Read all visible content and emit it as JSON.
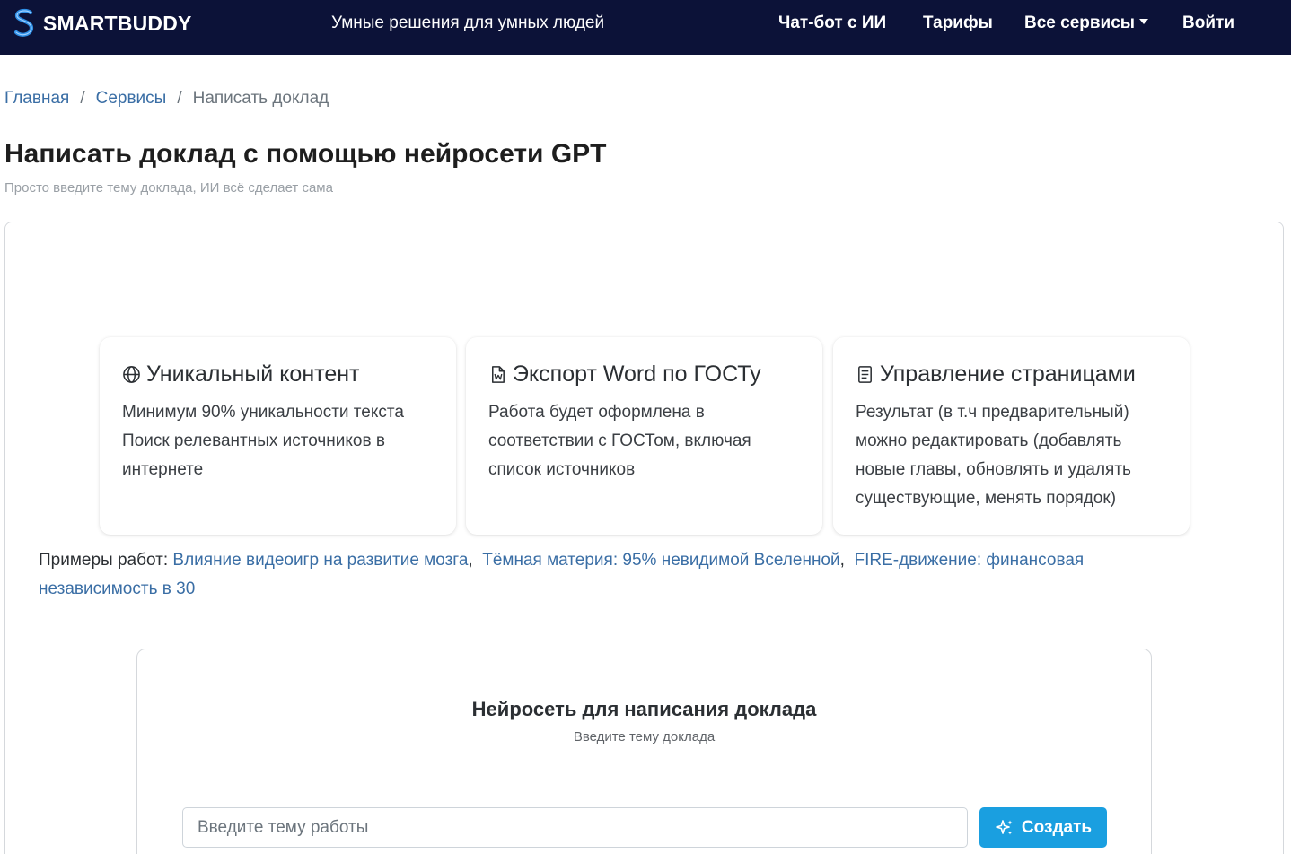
{
  "header": {
    "brand": "SMARTBUDDY",
    "tagline": "Умные решения для умных людей",
    "nav": {
      "chat": "Чат-бот с ИИ",
      "tariffs": "Тарифы",
      "services": "Все сервисы",
      "login": "Войти"
    },
    "colors": {
      "background": "#0c1238",
      "logo_accent": "#2f8fe6"
    }
  },
  "breadcrumb": {
    "home": "Главная",
    "services": "Сервисы",
    "current": "Написать доклад",
    "separator": "/"
  },
  "page": {
    "title": "Написать доклад с помощью нейросети GPT",
    "subtitle": "Просто введите тему доклада, ИИ всё сделает сама"
  },
  "features": [
    {
      "icon": "globe-icon",
      "title": "Уникальный контент",
      "text_lines": [
        "Минимум 90% уникальности текста",
        "Поиск релевантных источников в интернете"
      ]
    },
    {
      "icon": "word-file-icon",
      "title": "Экспорт Word по ГОСТу",
      "text": "Работа будет оформлена в соответствии с ГОСТом, включая список источников"
    },
    {
      "icon": "document-icon",
      "title": "Управление страницами",
      "text": "Результат (в т.ч предварительный) можно редактировать (добавлять новые главы, обновлять и удалять существующие, менять порядок)"
    }
  ],
  "examples": {
    "label": "Примеры работ:",
    "links": [
      "Влияние видеоигр на развитие мозга",
      "Тёмная материя: 95% невидимой Вселенной",
      "FIRE-движение: финансовая независимость в 30"
    ]
  },
  "generator": {
    "title": "Нейросеть для написания доклада",
    "subtitle": "Введите тему доклада",
    "input_placeholder": "Введите тему работы",
    "input_value": "",
    "button_label": "Создать",
    "button_icon": "sparkle-icon",
    "button_color": "#1a9fe0"
  },
  "link_color": "#3a6ea5"
}
